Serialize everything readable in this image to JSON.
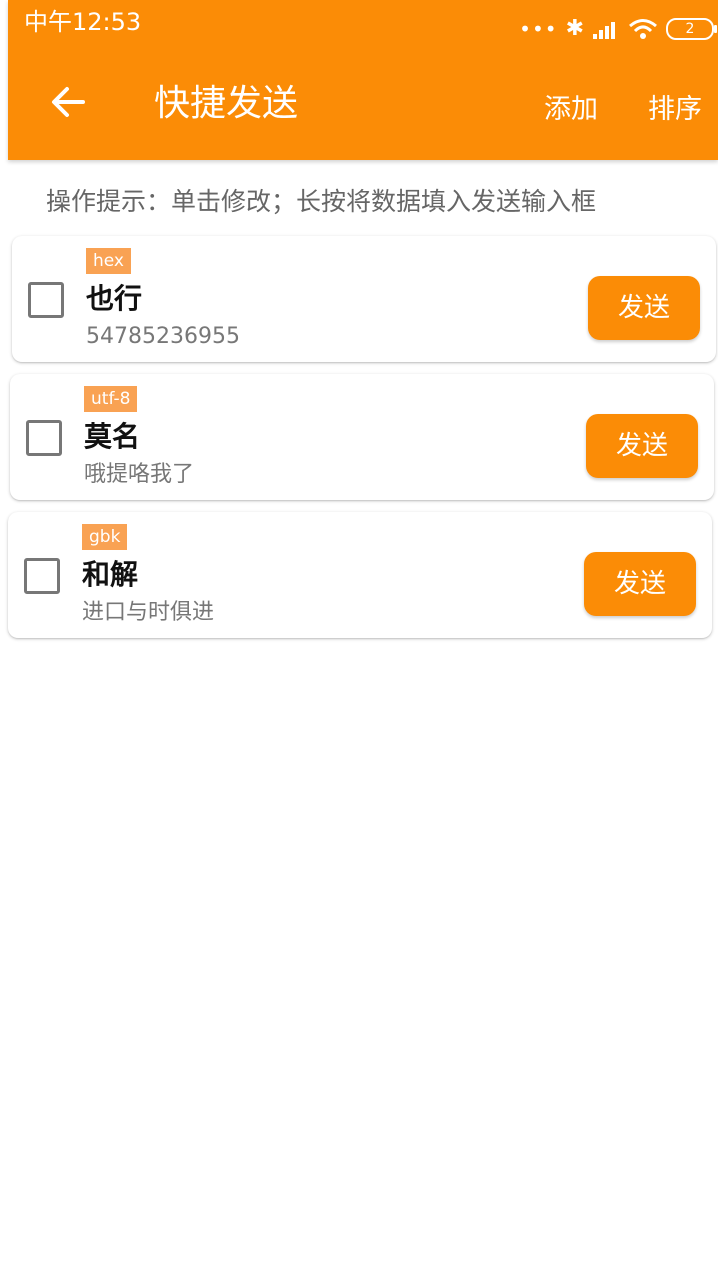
{
  "status_bar": {
    "time": "中午12:53",
    "signal_dots": "•••",
    "battery_level": "2"
  },
  "app_bar": {
    "title": "快捷发送",
    "add_label": "添加",
    "sort_label": "排序"
  },
  "hint": "操作提示：单击修改；长按将数据填入发送输入框",
  "items": [
    {
      "encoding": "hex",
      "name": "也行",
      "content": "54785236955",
      "send_label": "发送",
      "checked": false
    },
    {
      "encoding": "utf-8",
      "name": "莫名",
      "content": "哦提咯我了",
      "send_label": "发送",
      "checked": false
    },
    {
      "encoding": "gbk",
      "name": "和解",
      "content": "进口与时俱进",
      "send_label": "发送",
      "checked": false
    }
  ],
  "colors": {
    "primary": "#fb8c06",
    "tag_background": "#f9a253",
    "hint_text": "#666666"
  }
}
